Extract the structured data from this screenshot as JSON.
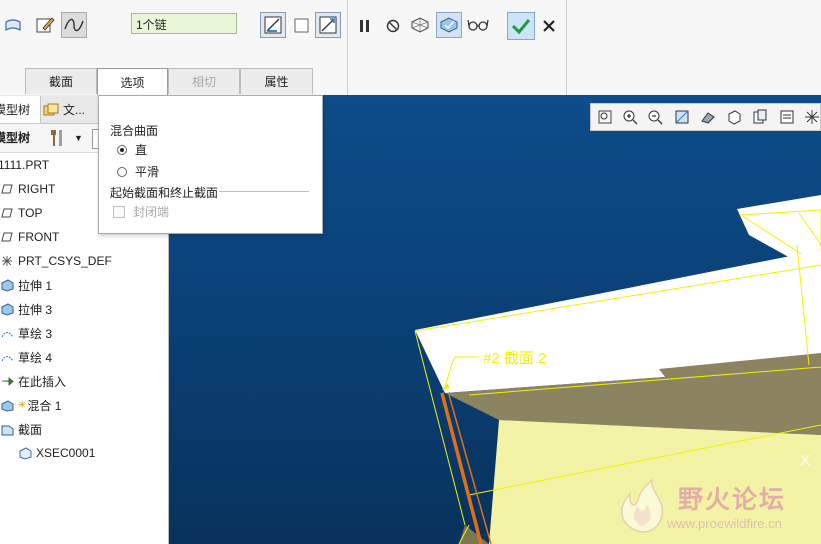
{
  "dashboard": {
    "chain_value": "1个链",
    "tabs": [
      {
        "label": "截面",
        "state": "normal"
      },
      {
        "label": "选项",
        "state": "active"
      },
      {
        "label": "相切",
        "state": "disabled"
      },
      {
        "label": "属性",
        "state": "normal"
      }
    ],
    "icons": [
      "section-icon",
      "sketch-edit-icon",
      "spline-curve-icon",
      "sketch-plane-icon",
      "checkbox-icon",
      "flip-direction-icon",
      "pause-icon",
      "no-preview-icon",
      "geometry-preview-icon",
      "verify-preview-icon",
      "glasses-icon",
      "ok-checkmark-icon",
      "cancel-x-icon"
    ]
  },
  "model_tree": {
    "tab_model_tree": "模型树",
    "tab_folder": "文...",
    "header_label": "模型树",
    "items": [
      {
        "label": "1111.PRT",
        "icon": "part-icon"
      },
      {
        "label": "RIGHT",
        "icon": "datum-plane-icon"
      },
      {
        "label": "TOP",
        "icon": "datum-plane-icon"
      },
      {
        "label": "FRONT",
        "icon": "datum-plane-icon"
      },
      {
        "label": "PRT_CSYS_DEF",
        "icon": "csys-icon"
      },
      {
        "label": "拉伸 1",
        "icon": "extrude-icon"
      },
      {
        "label": "拉伸 3",
        "icon": "extrude-icon"
      },
      {
        "label": "草绘 3",
        "icon": "sketch-icon"
      },
      {
        "label": "草绘 4",
        "icon": "sketch-icon"
      },
      {
        "label": "在此插入",
        "icon": "insert-here-arrow-icon"
      },
      {
        "label": "混合 1",
        "icon": "blend-icon"
      },
      {
        "label": "截面",
        "icon": "section-folder-icon"
      },
      {
        "label": "XSEC0001",
        "icon": "xsec-icon"
      }
    ]
  },
  "options_panel": {
    "blend_surface_heading": "混合曲面",
    "option_straight": "直",
    "option_smooth": "平滑",
    "section_heading": "起始截面和终止截面",
    "closed_ends_label": "封闭端",
    "selected": "直"
  },
  "viewport": {
    "section_label": "#2 截面 2",
    "corner_mark": "X",
    "colors": {
      "background": "#0a4480",
      "outline": "#f2f200",
      "surface_fill": "#f3f3a6",
      "edge": "#e07018"
    }
  },
  "watermark": {
    "title": "野火论坛",
    "url": "www.proewildfire.cn"
  }
}
